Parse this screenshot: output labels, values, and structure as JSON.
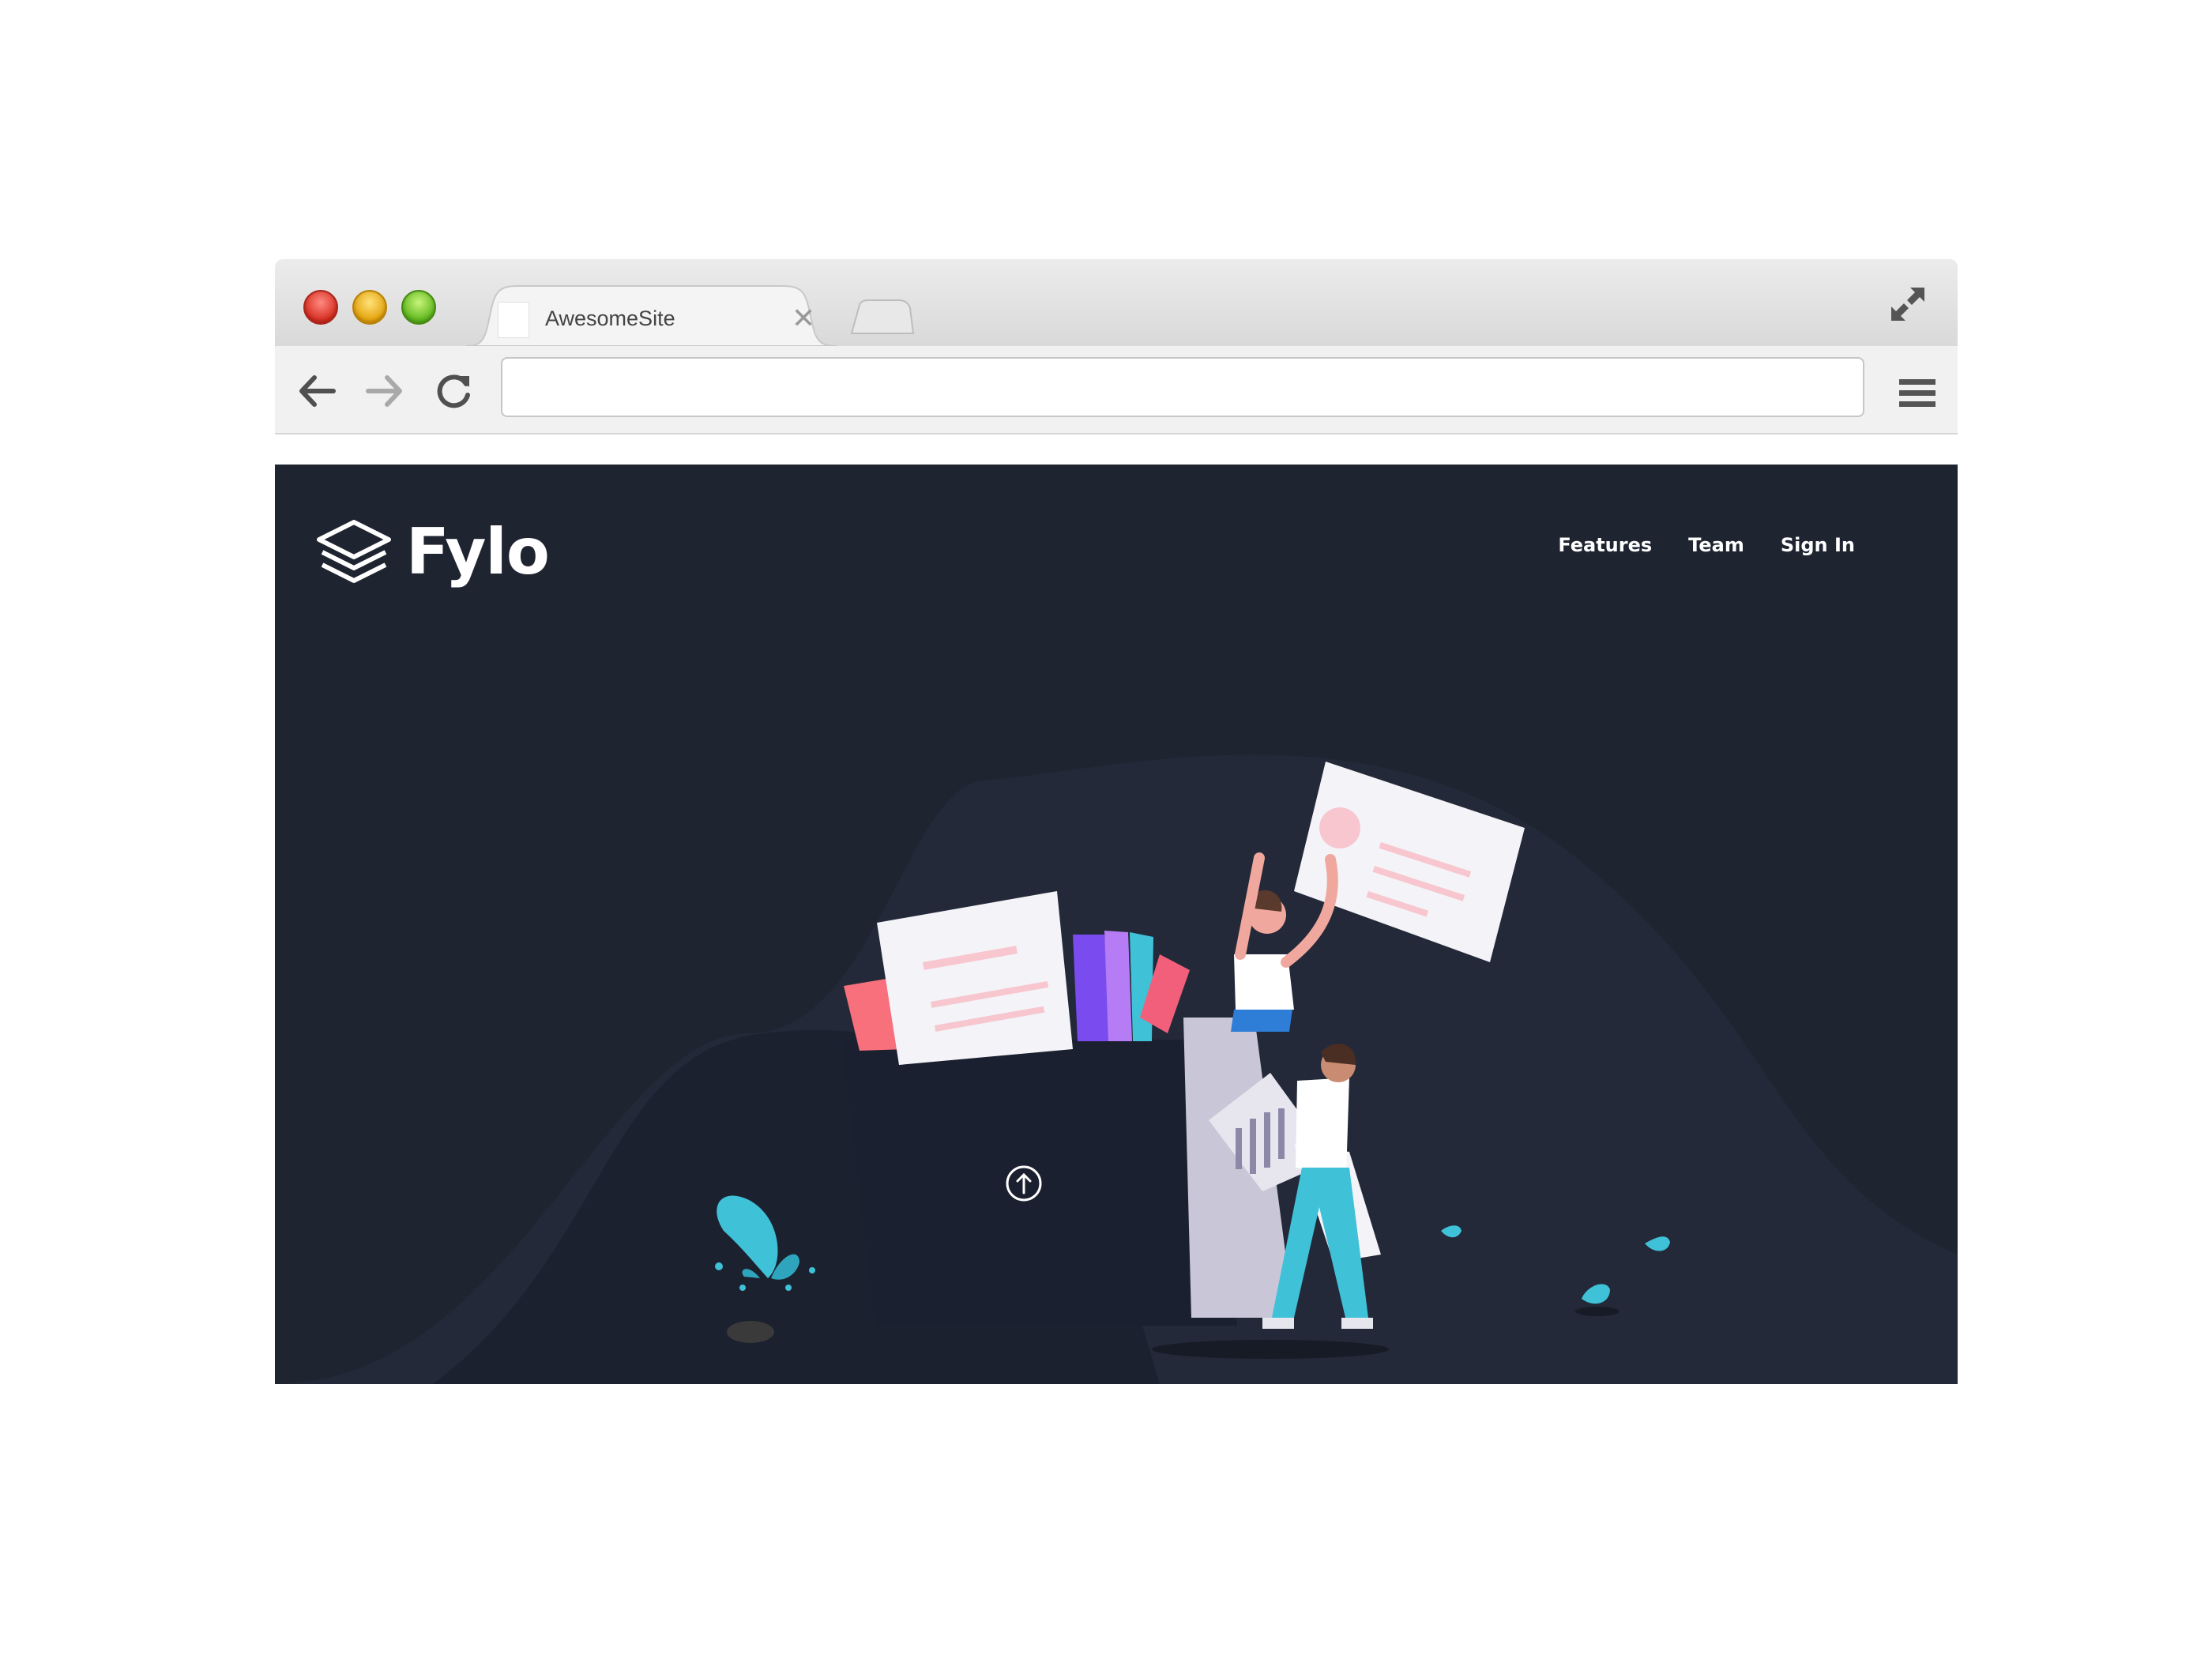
{
  "browser": {
    "tab_title": "AwesomeSite",
    "url": "",
    "icons": [
      "close-window-icon",
      "minimize-icon",
      "maximize-icon",
      "close-icon",
      "expand-icon",
      "back-arrow-icon",
      "forward-arrow-icon",
      "reload-icon",
      "hamburger-menu-icon"
    ]
  },
  "site": {
    "brand": "Fylo",
    "nav": [
      {
        "label": "Features"
      },
      {
        "label": "Team"
      },
      {
        "label": "Sign In"
      }
    ],
    "colors": {
      "background": "#1f2431",
      "text": "#ffffff",
      "accent_teal": "#3fc1d8",
      "accent_pink": "#f25f7a"
    }
  }
}
